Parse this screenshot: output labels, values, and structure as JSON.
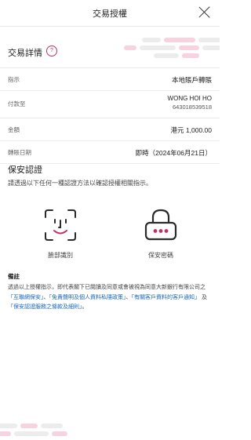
{
  "header": {
    "title": "交易授權"
  },
  "details": {
    "title": "交易詳情",
    "help_glyph": "?",
    "rows": [
      {
        "label": "指示",
        "value": "本地賬戶轉賬"
      },
      {
        "label": "付款至",
        "name": "WONG HOI HO",
        "account": "643018539518"
      },
      {
        "label": "金額",
        "value": "港元 1,000.00"
      },
      {
        "label": "轉賬日期",
        "value": "即時（2024年06月21日）"
      }
    ]
  },
  "security": {
    "title": "保安認證",
    "description": "請透過以下任何一種認證方法以確認授權相關指示。",
    "options": [
      {
        "label": "臉部識別",
        "icon": "face-recognition-icon"
      },
      {
        "label": "保安密碼",
        "icon": "padlock-password-icon"
      }
    ]
  },
  "remarks": {
    "title": "備註",
    "text_1": "透過以上授權指示，即代表閣下已閱讀及同意或會被視為同意大新銀行有限公司之",
    "link_1": "「互聯網保安」",
    "sep_1": "、",
    "link_2": "「免責聲明及個人資料私隱政策」",
    "sep_2": "、",
    "link_3": "「有關客戶資料的客戶通知」",
    "sep_3": " 及 ",
    "link_4": "「保安認證服務之條款及細則」",
    "end": "。"
  },
  "colors": {
    "accent": "#c0306a",
    "link": "#1565c0",
    "deco_pink": "#f6d3df",
    "deco_grey": "#ececec"
  }
}
